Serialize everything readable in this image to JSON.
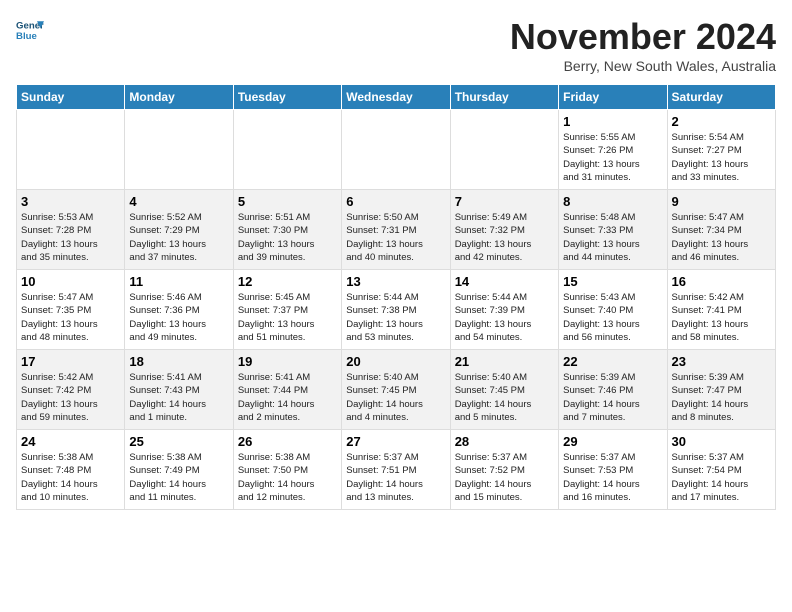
{
  "header": {
    "logo_line1": "General",
    "logo_line2": "Blue",
    "month": "November 2024",
    "location": "Berry, New South Wales, Australia"
  },
  "days_of_week": [
    "Sunday",
    "Monday",
    "Tuesday",
    "Wednesday",
    "Thursday",
    "Friday",
    "Saturday"
  ],
  "weeks": [
    [
      {
        "num": "",
        "info": ""
      },
      {
        "num": "",
        "info": ""
      },
      {
        "num": "",
        "info": ""
      },
      {
        "num": "",
        "info": ""
      },
      {
        "num": "",
        "info": ""
      },
      {
        "num": "1",
        "info": "Sunrise: 5:55 AM\nSunset: 7:26 PM\nDaylight: 13 hours\nand 31 minutes."
      },
      {
        "num": "2",
        "info": "Sunrise: 5:54 AM\nSunset: 7:27 PM\nDaylight: 13 hours\nand 33 minutes."
      }
    ],
    [
      {
        "num": "3",
        "info": "Sunrise: 5:53 AM\nSunset: 7:28 PM\nDaylight: 13 hours\nand 35 minutes."
      },
      {
        "num": "4",
        "info": "Sunrise: 5:52 AM\nSunset: 7:29 PM\nDaylight: 13 hours\nand 37 minutes."
      },
      {
        "num": "5",
        "info": "Sunrise: 5:51 AM\nSunset: 7:30 PM\nDaylight: 13 hours\nand 39 minutes."
      },
      {
        "num": "6",
        "info": "Sunrise: 5:50 AM\nSunset: 7:31 PM\nDaylight: 13 hours\nand 40 minutes."
      },
      {
        "num": "7",
        "info": "Sunrise: 5:49 AM\nSunset: 7:32 PM\nDaylight: 13 hours\nand 42 minutes."
      },
      {
        "num": "8",
        "info": "Sunrise: 5:48 AM\nSunset: 7:33 PM\nDaylight: 13 hours\nand 44 minutes."
      },
      {
        "num": "9",
        "info": "Sunrise: 5:47 AM\nSunset: 7:34 PM\nDaylight: 13 hours\nand 46 minutes."
      }
    ],
    [
      {
        "num": "10",
        "info": "Sunrise: 5:47 AM\nSunset: 7:35 PM\nDaylight: 13 hours\nand 48 minutes."
      },
      {
        "num": "11",
        "info": "Sunrise: 5:46 AM\nSunset: 7:36 PM\nDaylight: 13 hours\nand 49 minutes."
      },
      {
        "num": "12",
        "info": "Sunrise: 5:45 AM\nSunset: 7:37 PM\nDaylight: 13 hours\nand 51 minutes."
      },
      {
        "num": "13",
        "info": "Sunrise: 5:44 AM\nSunset: 7:38 PM\nDaylight: 13 hours\nand 53 minutes."
      },
      {
        "num": "14",
        "info": "Sunrise: 5:44 AM\nSunset: 7:39 PM\nDaylight: 13 hours\nand 54 minutes."
      },
      {
        "num": "15",
        "info": "Sunrise: 5:43 AM\nSunset: 7:40 PM\nDaylight: 13 hours\nand 56 minutes."
      },
      {
        "num": "16",
        "info": "Sunrise: 5:42 AM\nSunset: 7:41 PM\nDaylight: 13 hours\nand 58 minutes."
      }
    ],
    [
      {
        "num": "17",
        "info": "Sunrise: 5:42 AM\nSunset: 7:42 PM\nDaylight: 13 hours\nand 59 minutes."
      },
      {
        "num": "18",
        "info": "Sunrise: 5:41 AM\nSunset: 7:43 PM\nDaylight: 14 hours\nand 1 minute."
      },
      {
        "num": "19",
        "info": "Sunrise: 5:41 AM\nSunset: 7:44 PM\nDaylight: 14 hours\nand 2 minutes."
      },
      {
        "num": "20",
        "info": "Sunrise: 5:40 AM\nSunset: 7:45 PM\nDaylight: 14 hours\nand 4 minutes."
      },
      {
        "num": "21",
        "info": "Sunrise: 5:40 AM\nSunset: 7:45 PM\nDaylight: 14 hours\nand 5 minutes."
      },
      {
        "num": "22",
        "info": "Sunrise: 5:39 AM\nSunset: 7:46 PM\nDaylight: 14 hours\nand 7 minutes."
      },
      {
        "num": "23",
        "info": "Sunrise: 5:39 AM\nSunset: 7:47 PM\nDaylight: 14 hours\nand 8 minutes."
      }
    ],
    [
      {
        "num": "24",
        "info": "Sunrise: 5:38 AM\nSunset: 7:48 PM\nDaylight: 14 hours\nand 10 minutes."
      },
      {
        "num": "25",
        "info": "Sunrise: 5:38 AM\nSunset: 7:49 PM\nDaylight: 14 hours\nand 11 minutes."
      },
      {
        "num": "26",
        "info": "Sunrise: 5:38 AM\nSunset: 7:50 PM\nDaylight: 14 hours\nand 12 minutes."
      },
      {
        "num": "27",
        "info": "Sunrise: 5:37 AM\nSunset: 7:51 PM\nDaylight: 14 hours\nand 13 minutes."
      },
      {
        "num": "28",
        "info": "Sunrise: 5:37 AM\nSunset: 7:52 PM\nDaylight: 14 hours\nand 15 minutes."
      },
      {
        "num": "29",
        "info": "Sunrise: 5:37 AM\nSunset: 7:53 PM\nDaylight: 14 hours\nand 16 minutes."
      },
      {
        "num": "30",
        "info": "Sunrise: 5:37 AM\nSunset: 7:54 PM\nDaylight: 14 hours\nand 17 minutes."
      }
    ]
  ]
}
